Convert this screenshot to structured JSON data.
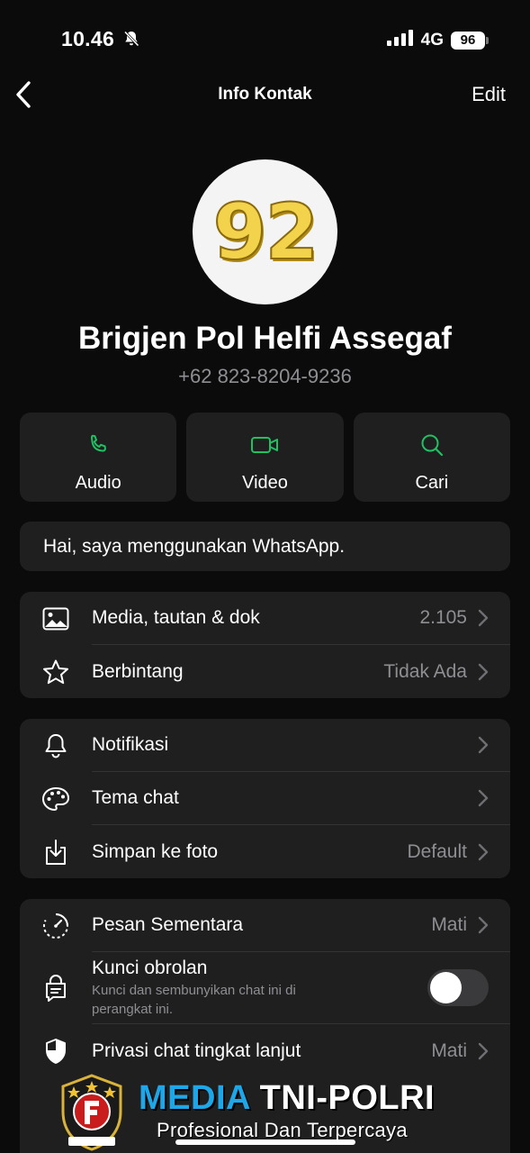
{
  "status_bar": {
    "time": "10.46",
    "network": "4G",
    "battery": "96"
  },
  "nav": {
    "title": "Info Kontak",
    "edit_label": "Edit"
  },
  "contact": {
    "avatar_text": "92",
    "name": "Brigjen Pol Helfi Assegaf",
    "phone": "+62 823-8204-9236"
  },
  "actions": [
    {
      "label": "Audio",
      "icon": "phone-icon"
    },
    {
      "label": "Video",
      "icon": "video-icon"
    },
    {
      "label": "Cari",
      "icon": "search-icon"
    }
  ],
  "about": "Hai, saya menggunakan WhatsApp.",
  "section_media": [
    {
      "label": "Media, tautan & dok",
      "value": "2.105",
      "icon": "image-icon"
    },
    {
      "label": "Berbintang",
      "value": "Tidak Ada",
      "icon": "star-icon"
    }
  ],
  "section_settings": [
    {
      "label": "Notifikasi",
      "value": "",
      "icon": "bell-icon"
    },
    {
      "label": "Tema chat",
      "value": "",
      "icon": "palette-icon"
    },
    {
      "label": "Simpan ke foto",
      "value": "Default",
      "icon": "download-icon"
    }
  ],
  "section_privacy": {
    "disappearing": {
      "label": "Pesan Sementara",
      "value": "Mati",
      "icon": "timer-icon"
    },
    "chat_lock": {
      "label": "Kunci obrolan",
      "description": "Kunci dan sembunyikan chat ini di perangkat ini.",
      "toggle_on": false,
      "icon": "lock-chat-icon"
    },
    "advanced_privacy": {
      "label": "Privasi chat tingkat lanjut",
      "value": "Mati",
      "icon": "shield-icon"
    }
  },
  "watermark": {
    "title_part1": "MEDIA",
    "title_part2": "TNI-POLRI",
    "tagline": "Profesional Dan Terpercaya"
  },
  "colors": {
    "accent_green": "#21c063",
    "background": "#0b0b0b",
    "card": "#1f1f1f",
    "secondary_text": "#8e8e93",
    "watermark_blue": "#1ea7e8"
  }
}
